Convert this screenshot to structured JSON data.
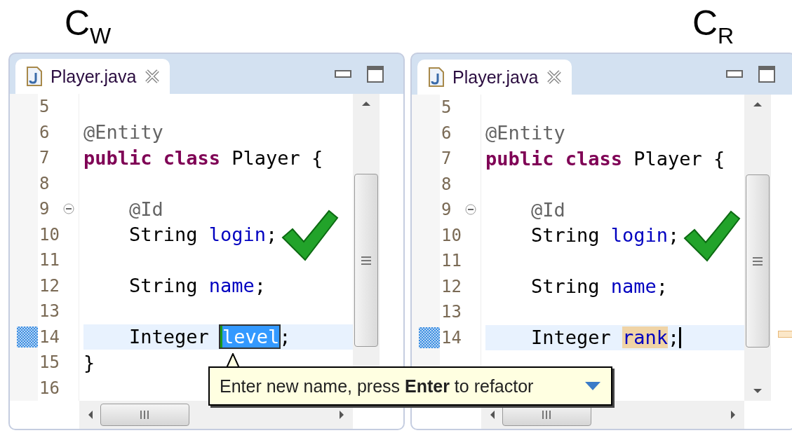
{
  "editors": [
    {
      "heading": "C$_{W}$",
      "tab": {
        "title": "Player.java",
        "selected": true
      },
      "overview_marker": false,
      "lines": [
        {
          "number": "5",
          "current": false,
          "foldable": false,
          "checkmark": false,
          "caret": false
        },
        {
          "number": "6",
          "current": false,
          "foldable": false,
          "checkmark": false,
          "caret": false,
          "tokens": [
            {
              "text": "@Entity",
              "kind": "annotation"
            }
          ]
        },
        {
          "number": "7",
          "current": false,
          "foldable": false,
          "checkmark": false,
          "caret": false,
          "tokens": [
            {
              "text": "public class",
              "kind": "keyword"
            },
            {
              "text": " Player {",
              "kind": "plain"
            }
          ]
        },
        {
          "number": "8",
          "current": false,
          "foldable": false,
          "checkmark": false,
          "caret": false
        },
        {
          "number": "9",
          "current": false,
          "foldable": true,
          "checkmark": false,
          "caret": false,
          "tokens": [
            {
              "text": "    @Id",
              "kind": "annotation"
            }
          ]
        },
        {
          "number": "10",
          "current": false,
          "foldable": false,
          "checkmark": true,
          "caret": false,
          "tokens": [
            {
              "text": "    String ",
              "kind": "plain"
            },
            {
              "text": "login",
              "kind": "field"
            },
            {
              "text": ";",
              "kind": "plain"
            }
          ]
        },
        {
          "number": "11",
          "current": false,
          "foldable": false,
          "checkmark": false,
          "caret": false
        },
        {
          "number": "12",
          "current": false,
          "foldable": false,
          "checkmark": false,
          "caret": false,
          "tokens": [
            {
              "text": "    String ",
              "kind": "plain"
            },
            {
              "text": "name",
              "kind": "field"
            },
            {
              "text": ";",
              "kind": "plain"
            }
          ]
        },
        {
          "number": "13",
          "current": false,
          "foldable": false,
          "checkmark": false,
          "caret": false
        },
        {
          "number": "14",
          "current": true,
          "foldable": false,
          "checkmark": false,
          "caret": false,
          "tokens": [
            {
              "text": "    Integer ",
              "kind": "plain"
            },
            {
              "text": "level",
              "kind": "linked-edit"
            },
            {
              "text": ";",
              "kind": "plain"
            }
          ]
        },
        {
          "number": "15",
          "current": false,
          "foldable": false,
          "checkmark": false,
          "caret": false,
          "tokens": [
            {
              "text": "}",
              "kind": "plain"
            }
          ]
        },
        {
          "number": "16",
          "current": false,
          "foldable": false,
          "checkmark": false,
          "caret": false
        }
      ]
    },
    {
      "heading": "C$_{R}$",
      "tab": {
        "title": "Player.java",
        "selected": true
      },
      "overview_marker": true,
      "lines": [
        {
          "number": "5",
          "current": false,
          "foldable": false,
          "checkmark": false,
          "caret": false
        },
        {
          "number": "6",
          "current": false,
          "foldable": false,
          "checkmark": false,
          "caret": false,
          "tokens": [
            {
              "text": "@Entity",
              "kind": "annotation"
            }
          ]
        },
        {
          "number": "7",
          "current": false,
          "foldable": false,
          "checkmark": false,
          "caret": false,
          "tokens": [
            {
              "text": "public class",
              "kind": "keyword"
            },
            {
              "text": " Player {",
              "kind": "plain"
            }
          ]
        },
        {
          "number": "8",
          "current": false,
          "foldable": false,
          "checkmark": false,
          "caret": false
        },
        {
          "number": "9",
          "current": false,
          "foldable": true,
          "checkmark": false,
          "caret": false,
          "tokens": [
            {
              "text": "    @Id",
              "kind": "annotation"
            }
          ]
        },
        {
          "number": "10",
          "current": false,
          "foldable": false,
          "checkmark": true,
          "caret": false,
          "tokens": [
            {
              "text": "    String ",
              "kind": "plain"
            },
            {
              "text": "login",
              "kind": "field"
            },
            {
              "text": ";",
              "kind": "plain"
            }
          ]
        },
        {
          "number": "11",
          "current": false,
          "foldable": false,
          "checkmark": false,
          "caret": false
        },
        {
          "number": "12",
          "current": false,
          "foldable": false,
          "checkmark": false,
          "caret": false,
          "tokens": [
            {
              "text": "    String ",
              "kind": "plain"
            },
            {
              "text": "name",
              "kind": "field"
            },
            {
              "text": ";",
              "kind": "plain"
            }
          ]
        },
        {
          "number": "13",
          "current": false,
          "foldable": false,
          "checkmark": false,
          "caret": false
        },
        {
          "number": "14",
          "current": true,
          "foldable": false,
          "checkmark": false,
          "caret": true,
          "tokens": [
            {
              "text": "    Integer ",
              "kind": "plain"
            },
            {
              "text": "rank",
              "kind": "occurrence"
            },
            {
              "text": ";",
              "kind": "plain"
            }
          ]
        }
      ]
    }
  ],
  "tooltip": {
    "text": "Enter new name, press **Enter** to refactor"
  }
}
